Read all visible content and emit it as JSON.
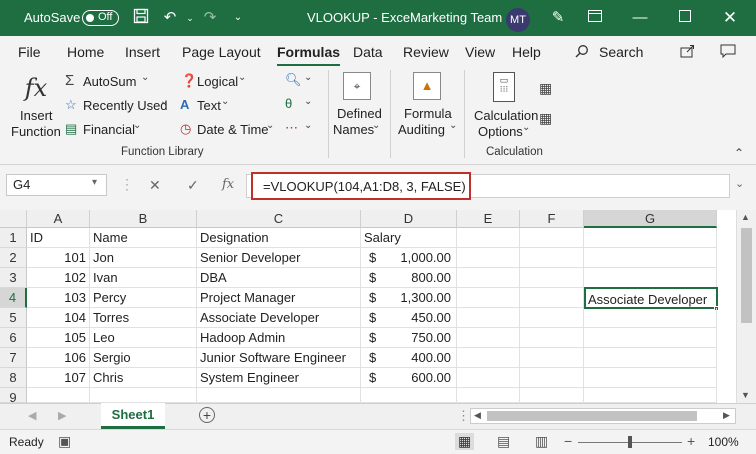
{
  "titlebar": {
    "autosave_label": "AutoSave",
    "autosave_state": "Off",
    "document_title": "VLOOKUP  -  Excel",
    "team": "Marketing Team",
    "avatar_initials": "MT"
  },
  "menu": {
    "tabs": [
      "File",
      "Home",
      "Insert",
      "Page Layout",
      "Formulas",
      "Data",
      "Review",
      "View",
      "Help"
    ],
    "active": "Formulas",
    "search_label": "Search"
  },
  "ribbon": {
    "insert_function": [
      "Insert",
      "Function"
    ],
    "autosum": "AutoSum",
    "recently_used": "Recently Used",
    "financial": "Financial",
    "logical": "Logical",
    "text": "Text",
    "date_time": "Date & Time",
    "defined_names": [
      "Defined",
      "Names"
    ],
    "formula_auditing": [
      "Formula",
      "Auditing"
    ],
    "calculation_options": [
      "Calculation",
      "Options"
    ],
    "group_function_library": "Function Library",
    "group_calculation": "Calculation"
  },
  "formula_bar": {
    "name_box": "G4",
    "fx": "fx",
    "formula": "=VLOOKUP(104,A1:D8, 3, FALSE)"
  },
  "grid": {
    "columns": [
      "A",
      "B",
      "C",
      "D",
      "E",
      "F",
      "G"
    ],
    "rows": [
      "1",
      "2",
      "3",
      "4",
      "5",
      "6",
      "7",
      "8",
      "9"
    ],
    "header": [
      "ID",
      "Name",
      "Designation",
      "Salary"
    ],
    "currency": "$",
    "data": [
      [
        "101",
        "Jon",
        "Senior Developer",
        "1,000.00"
      ],
      [
        "102",
        "Ivan",
        "DBA",
        "800.00"
      ],
      [
        "103",
        "Percy",
        "Project Manager",
        "1,300.00"
      ],
      [
        "104",
        "Torres",
        "Associate Developer",
        "450.00"
      ],
      [
        "105",
        "Leo",
        "Hadoop Admin",
        "750.00"
      ],
      [
        "106",
        "Sergio",
        "Junior Software Engineer",
        "400.00"
      ],
      [
        "107",
        "Chris",
        "System Engineer",
        "600.00"
      ]
    ],
    "g4_value": "Associate Developer"
  },
  "sheets": {
    "active": "Sheet1",
    "add": "+"
  },
  "status": {
    "ready": "Ready",
    "zoom": "100%",
    "minus": "−",
    "plus": "+"
  }
}
